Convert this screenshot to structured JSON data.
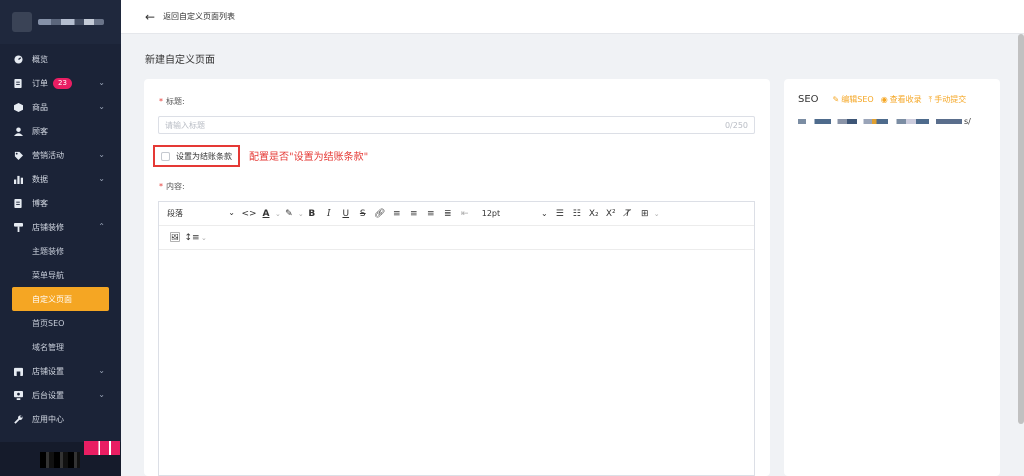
{
  "sidebar": {
    "items": [
      {
        "label": "概览",
        "icon": "dashboard-icon"
      },
      {
        "label": "订单",
        "icon": "order-icon",
        "badge": "23",
        "expandable": true
      },
      {
        "label": "商品",
        "icon": "product-icon",
        "expandable": true
      },
      {
        "label": "顾客",
        "icon": "customer-icon"
      },
      {
        "label": "营销活动",
        "icon": "marketing-icon",
        "expandable": true
      },
      {
        "label": "数据",
        "icon": "chart-icon",
        "expandable": true
      },
      {
        "label": "博客",
        "icon": "blog-icon"
      },
      {
        "label": "店铺装修",
        "icon": "brush-icon",
        "expanded": true
      }
    ],
    "sub_items": [
      "主题装修",
      "菜单导航",
      "自定义页面",
      "首页SEO",
      "域名管理"
    ],
    "active_sub": "自定义页面",
    "bottom_items": [
      {
        "label": "店铺设置",
        "icon": "store-icon"
      },
      {
        "label": "后台设置",
        "icon": "admin-icon"
      },
      {
        "label": "应用中心",
        "icon": "wrench-icon"
      }
    ]
  },
  "topbar": {
    "back_label": "返回自定义页面列表"
  },
  "page": {
    "title": "新建自定义页面"
  },
  "form": {
    "title_label": "标题:",
    "title_placeholder": "请输入标题",
    "title_counter": "0/250",
    "checkout_label": "设置为结账条款",
    "annotation": "配置是否\"设置为结账条款\"",
    "content_label": "内容:"
  },
  "editor": {
    "format_value": "段落",
    "font_size_value": "12pt"
  },
  "seo": {
    "title": "SEO",
    "edit_label": "编辑SEO",
    "view_label": "查看收录",
    "submit_label": "手动提交",
    "url_suffix": "s/"
  },
  "colors": {
    "accent": "#f5a623",
    "sidebar_bg": "#1b2337",
    "badge": "#e91e63",
    "annotation": "#e53935"
  }
}
